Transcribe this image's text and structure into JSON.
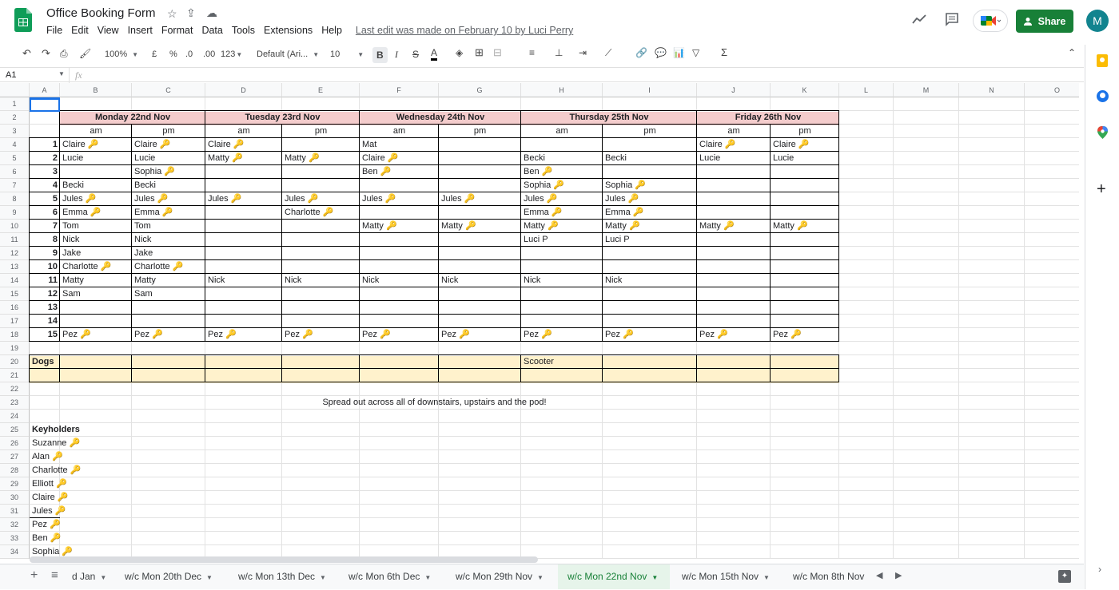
{
  "app": {
    "title": "Office Booking Form",
    "menus": [
      "File",
      "Edit",
      "View",
      "Insert",
      "Format",
      "Data",
      "Tools",
      "Extensions",
      "Help"
    ],
    "last_edit": "Last edit was made on February 10 by Luci Perry",
    "share_label": "Share",
    "avatar_initial": "M"
  },
  "toolbar": {
    "zoom": "100%",
    "currency": "£",
    "percent": "%",
    "dec_decrease": ".0",
    "dec_increase": ".00",
    "number_format": "123",
    "font": "Default (Ari...",
    "font_size": "10",
    "bold": "B",
    "strike": "S",
    "text_color": "A"
  },
  "formula_bar": {
    "cell_ref": "A1",
    "fx": "fx",
    "value": ""
  },
  "columns": [
    "A",
    "B",
    "C",
    "D",
    "E",
    "F",
    "G",
    "H",
    "I",
    "J",
    "K",
    "L",
    "M",
    "N",
    "O"
  ],
  "rows": [
    "1",
    "2",
    "3",
    "4",
    "5",
    "6",
    "7",
    "8",
    "9",
    "10",
    "11",
    "12",
    "13",
    "14",
    "15",
    "16",
    "17",
    "18",
    "19",
    "20",
    "21",
    "22",
    "23",
    "24",
    "25",
    "26",
    "27",
    "28",
    "29",
    "30",
    "31",
    "32",
    "33",
    "34"
  ],
  "days": [
    "Monday 22nd Nov",
    "Tuesday 23rd Nov",
    "Wednesday 24th Nov",
    "Thursday 25th Nov",
    "Friday 26th Nov"
  ],
  "am": "am",
  "pm": "pm",
  "bookings": [
    {
      "n": "1",
      "cells": [
        "Claire 🔑",
        "Claire 🔑",
        "Claire 🔑",
        "",
        "Mat",
        "",
        "",
        "",
        "Claire 🔑",
        "Claire 🔑"
      ]
    },
    {
      "n": "2",
      "cells": [
        "Lucie",
        "Lucie",
        "Matty 🔑",
        "Matty 🔑",
        "Claire 🔑",
        "",
        "Becki",
        "Becki",
        "Lucie",
        "Lucie"
      ]
    },
    {
      "n": "3",
      "cells": [
        "",
        "Sophia 🔑",
        "",
        "",
        "Ben 🔑",
        "",
        "Ben 🔑",
        "",
        "",
        ""
      ]
    },
    {
      "n": "4",
      "cells": [
        "Becki",
        "Becki",
        "",
        "",
        "",
        "",
        "Sophia 🔑",
        "Sophia 🔑",
        "",
        ""
      ]
    },
    {
      "n": "5",
      "cells": [
        "Jules 🔑",
        "Jules 🔑",
        "Jules 🔑",
        "Jules 🔑",
        "Jules 🔑",
        "Jules 🔑",
        "Jules 🔑",
        "Jules 🔑",
        "",
        ""
      ]
    },
    {
      "n": "6",
      "cells": [
        "Emma 🔑",
        "Emma 🔑",
        "",
        "Charlotte 🔑",
        "",
        "",
        "Emma 🔑",
        "Emma 🔑",
        "",
        ""
      ]
    },
    {
      "n": "7",
      "cells": [
        "Tom",
        "Tom",
        "",
        "",
        "Matty 🔑",
        "Matty 🔑",
        "Matty 🔑",
        "Matty 🔑",
        "Matty 🔑",
        "Matty 🔑"
      ]
    },
    {
      "n": "8",
      "cells": [
        "Nick",
        "Nick",
        "",
        "",
        "",
        "",
        "Luci P",
        "Luci P",
        "",
        ""
      ]
    },
    {
      "n": "9",
      "cells": [
        "Jake",
        "Jake",
        "",
        "",
        "",
        "",
        "",
        "",
        "",
        ""
      ]
    },
    {
      "n": "10",
      "cells": [
        "Charlotte 🔑",
        "Charlotte 🔑",
        "",
        "",
        "",
        "",
        "",
        "",
        "",
        ""
      ]
    },
    {
      "n": "11",
      "cells": [
        "Matty",
        "Matty",
        "Nick",
        "Nick",
        "Nick",
        "Nick",
        "Nick",
        "Nick",
        "",
        ""
      ]
    },
    {
      "n": "12",
      "cells": [
        "Sam",
        "Sam",
        "",
        "",
        "",
        "",
        "",
        "",
        "",
        ""
      ]
    },
    {
      "n": "13",
      "cells": [
        "",
        "",
        "",
        "",
        "",
        "",
        "",
        "",
        "",
        ""
      ]
    },
    {
      "n": "14",
      "cells": [
        "",
        "",
        "",
        "",
        "",
        "",
        "",
        "",
        "",
        ""
      ]
    },
    {
      "n": "15",
      "cells": [
        "Pez 🔑",
        "Pez 🔑",
        "Pez 🔑",
        "Pez 🔑",
        "Pez 🔑",
        "Pez 🔑",
        "Pez 🔑",
        "Pez 🔑",
        "Pez 🔑",
        "Pez 🔑"
      ]
    }
  ],
  "dogs_label": "Dogs",
  "dogs": [
    "",
    "",
    "",
    "",
    "",
    "",
    "Scooter",
    "",
    "",
    ""
  ],
  "note": "Spread out across all of downstairs, upstairs and the pod!",
  "keyholders_label": "Keyholders",
  "keyholders": [
    "Suzanne 🔑",
    "Alan 🔑",
    "Charlotte 🔑",
    "Elliott 🔑",
    "Claire 🔑",
    "Jules 🔑",
    "Pez 🔑",
    "Ben 🔑",
    "Sophia 🔑"
  ],
  "sheet_tabs": [
    "d Jan",
    "w/c Mon 20th Dec",
    "w/c Mon 13th Dec",
    "w/c Mon 6th Dec",
    "w/c Mon 29th Nov",
    "w/c Mon 22nd Nov",
    "w/c Mon 15th Nov",
    "w/c Mon 8th Nov"
  ],
  "active_tab": "w/c Mon 22nd Nov",
  "colors": {
    "header_pink": "#f4cccc",
    "dogs_yellow": "#fff2cc",
    "share_green": "#188038",
    "key_gold": "#d4a017"
  }
}
